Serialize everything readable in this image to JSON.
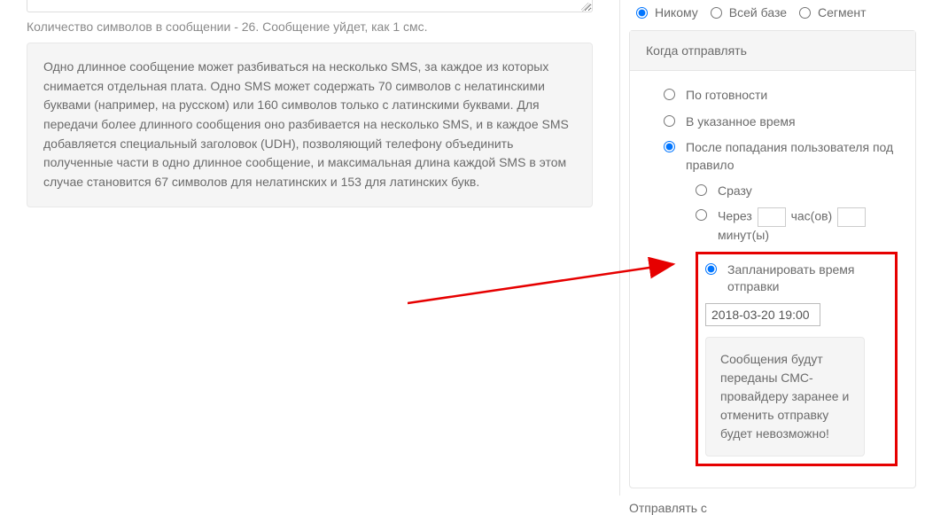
{
  "left": {
    "char_count_text": "Количество символов в сообщении - 26. Сообщение уйдет, как 1 смс.",
    "info_text": "Одно длинное сообщение может разбиваться на несколько SMS, за каждое из которых снимается отдельная плата. Одно SMS может содержать 70 символов с нелатинскими буквами (например, на русском) или 160 символов только с латинскими буквами. Для передачи более длинного сообщения оно разбивается на несколько SMS, и в каждое SMS добавляется специальный заголовок (UDH), позволяющий телефону объединить полученные части в одно длинное сообщение, и максимальная длина каждой SMS в этом случае становится 67 символов для нелатинских и 153 для латинских букв."
  },
  "right": {
    "audience": {
      "nobody": "Никому",
      "all_base": "Всей базе",
      "segment": "Сегмент"
    },
    "when_panel": {
      "title": "Когда отправлять",
      "opt_ready": "По готовности",
      "opt_at_time": "В указанное время",
      "opt_after_rule": "После попадания пользователя под правило",
      "sub_immediate": "Сразу",
      "sub_delay_prefix": "Через",
      "sub_delay_hours": "час(ов)",
      "sub_delay_minutes": "минут(ы)",
      "sub_schedule": "Запланировать время отправки",
      "schedule_value": "2018-03-20 19:00",
      "schedule_warn": "Сообщения будут переданы СМС-провайдеру заранее и отменить отправку будет невозможно!"
    },
    "send_from_label": "Отправлять с"
  }
}
